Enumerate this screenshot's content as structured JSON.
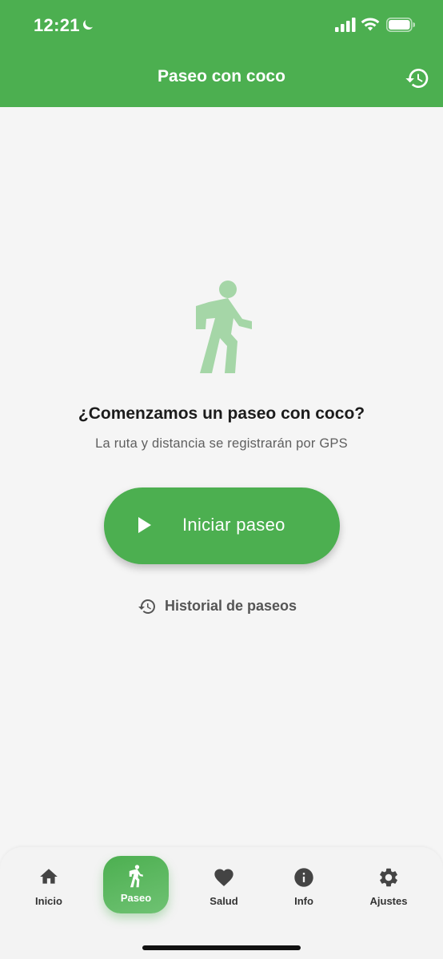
{
  "status_bar": {
    "time": "12:21",
    "icons": [
      "moon-icon",
      "signal-icon",
      "wifi-icon",
      "battery-icon"
    ]
  },
  "app_bar": {
    "title": "Paseo con coco",
    "action_icon": "history-icon"
  },
  "main": {
    "illustration_icon": "walking-person-icon",
    "headline": "¿Comenzamos un paseo con coco?",
    "subtitle": "La ruta y distancia se registrarán por GPS",
    "start_button": {
      "icon": "play-icon",
      "label": "Iniciar paseo"
    },
    "history_link": {
      "icon": "history-icon",
      "label": "Historial de paseos"
    }
  },
  "bottom_nav": {
    "active": "Paseo",
    "items": [
      {
        "icon": "home-icon",
        "label": "Inicio"
      },
      {
        "icon": "walk-icon",
        "label": "Paseo"
      },
      {
        "icon": "heart-icon",
        "label": "Salud"
      },
      {
        "icon": "info-icon",
        "label": "Info"
      },
      {
        "icon": "gear-icon",
        "label": "Ajustes"
      }
    ]
  },
  "colors": {
    "primary": "#4caf50",
    "illustration": "#a5d6a7",
    "background": "#f5f5f5",
    "nav_background": "#f3f3f3",
    "text_secondary": "#5f5f5f"
  }
}
